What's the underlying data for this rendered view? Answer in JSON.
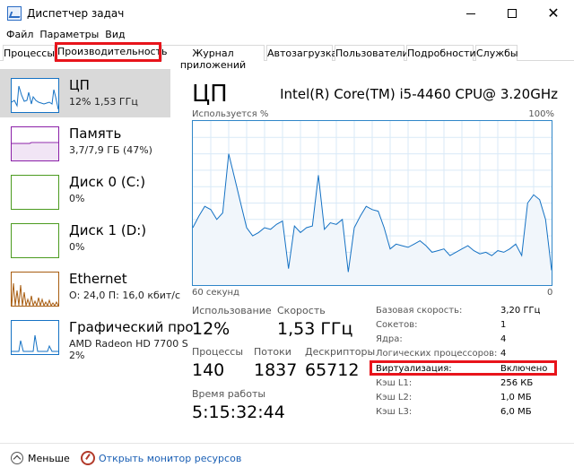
{
  "window": {
    "title": "Диспетчер задач",
    "minimize_icon": "minimize-icon",
    "maximize_icon": "maximize-icon",
    "close_icon": "close-icon"
  },
  "menu": [
    "Файл",
    "Параметры",
    "Вид"
  ],
  "tabs": [
    "Процессы",
    "Производительность",
    "Журнал приложений",
    "Автозагрузка",
    "Пользователи",
    "Подробности",
    "Службы"
  ],
  "active_tab": "Производительность",
  "sidebar": {
    "items": [
      {
        "title": "ЦП",
        "sub1": "12% 1,53 ГГц",
        "sub2": "",
        "color": "#1572c4"
      },
      {
        "title": "Память",
        "sub1": "3,7/7,9 ГБ (47%)",
        "sub2": "",
        "color": "#8b20a8"
      },
      {
        "title": "Диск 0 (C:)",
        "sub1": "0%",
        "sub2": "",
        "color": "#4b9b1f"
      },
      {
        "title": "Диск 1 (D:)",
        "sub1": "0%",
        "sub2": "",
        "color": "#4b9b1f"
      },
      {
        "title": "Ethernet",
        "sub1": "О: 24,0 П: 16,0 кбит/с",
        "sub2": "",
        "color": "#a85d11"
      },
      {
        "title": "Графический про",
        "sub1": "AMD Radeon HD 7700 S",
        "sub2": "2%",
        "color": "#1572c4"
      }
    ]
  },
  "main": {
    "title": "ЦП",
    "model": "Intel(R) Core(TM) i5-4460 CPU@ 3.20GHz",
    "graph_left_label": "Используется %",
    "graph_right_label": "100%",
    "axis_left": "60 секунд",
    "axis_right": "0",
    "stats": {
      "usage_label": "Использование",
      "usage_value": "12%",
      "speed_label": "Скорость",
      "speed_value": "1,53 ГГц",
      "processes_label": "Процессы",
      "processes_value": "140",
      "threads_label": "Потоки",
      "threads_value": "1837",
      "handles_label": "Дескрипторы",
      "handles_value": "65712",
      "uptime_label": "Время работы",
      "uptime_value": "5:15:32:44"
    },
    "info": [
      {
        "label": "Базовая скорость:",
        "value": "3,20 ГГц"
      },
      {
        "label": "Сокетов:",
        "value": "1"
      },
      {
        "label": "Ядра:",
        "value": "4"
      },
      {
        "label": "Логических процессоров:",
        "value": "4"
      },
      {
        "label": "Виртуализация:",
        "value": "Включено"
      },
      {
        "label": "Кэш L1:",
        "value": "256 КБ"
      },
      {
        "label": "Кэш L2:",
        "value": "1,0 МБ"
      },
      {
        "label": "Кэш L3:",
        "value": "6,0 МБ"
      }
    ]
  },
  "footer": {
    "less": "Меньше",
    "monitor": "Открыть монитор ресурсов"
  },
  "chart_data": {
    "type": "area",
    "x_range": [
      60,
      0
    ],
    "ylim": [
      0,
      100
    ],
    "grid": true,
    "values": [
      35,
      42,
      48,
      46,
      40,
      44,
      80,
      65,
      50,
      35,
      30,
      32,
      35,
      34,
      37,
      39,
      10,
      36,
      32,
      35,
      36,
      67,
      34,
      38,
      37,
      40,
      8,
      35,
      42,
      48,
      46,
      45,
      35,
      22,
      25,
      24,
      23,
      25,
      27,
      24,
      20,
      21,
      22,
      18,
      20,
      22,
      24,
      21,
      19,
      20,
      18,
      21,
      20,
      22,
      25,
      18,
      50,
      55,
      52,
      40,
      9
    ]
  }
}
